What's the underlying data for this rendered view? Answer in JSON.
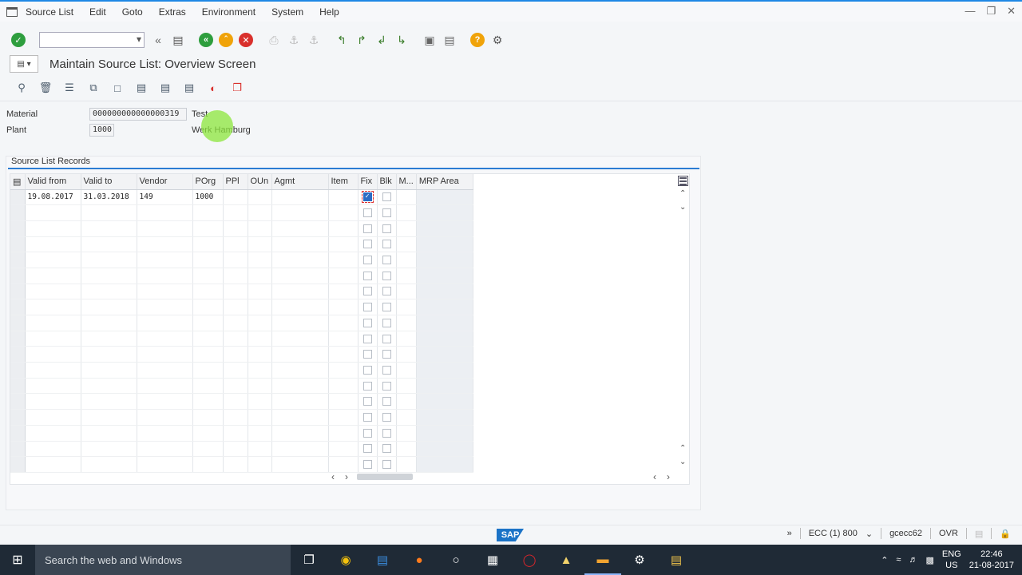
{
  "window": {
    "menu": [
      "Source List",
      "Edit",
      "Goto",
      "Extras",
      "Environment",
      "System",
      "Help"
    ],
    "controls": [
      "minimize-icon",
      "restore-icon",
      "close-icon"
    ]
  },
  "toolbar": {
    "command_field": "",
    "icons": [
      "enter-icon",
      "back-arrows-icon",
      "save-icon",
      "back-icon",
      "exit-icon",
      "cancel-icon",
      "print-icon",
      "find-icon",
      "find-next-icon",
      "first-page-icon",
      "prev-page-icon",
      "next-page-icon",
      "last-page-icon",
      "new-session-icon",
      "shortcut-icon",
      "help-icon",
      "settings-icon"
    ]
  },
  "title": {
    "text": "Maintain Source List: Overview Screen"
  },
  "app_toolbar": {
    "icons": [
      "details-icon",
      "delete-icon",
      "select-block-icon",
      "copy-icon",
      "new-icon",
      "generate-icon",
      "analyze-icon",
      "export-icon",
      "check-icon",
      "copy-doc-icon"
    ]
  },
  "header": {
    "material_label": "Material",
    "material_value": "000000000000000319",
    "material_desc": "Test",
    "plant_label": "Plant",
    "plant_value": "1000",
    "plant_desc": "Werk Hamburg"
  },
  "records": {
    "title": "Source List Records",
    "columns": [
      "Valid from",
      "Valid to",
      "Vendor",
      "POrg",
      "PPl",
      "OUn",
      "Agmt",
      "Item",
      "Fix",
      "Blk",
      "M...",
      "MRP Area"
    ],
    "rows": [
      {
        "valid_from": "19.08.2017",
        "valid_to": "31.03.2018",
        "vendor": "149",
        "porg": "1000",
        "fix": true,
        "blk": false
      }
    ],
    "empty_rows": 17
  },
  "status": {
    "system": "ECC (1) 800",
    "server": "gcecc62",
    "mode": "OVR",
    "logo": "SAP"
  },
  "taskbar": {
    "search_placeholder": "Search the web and Windows",
    "lang_top": "ENG",
    "lang_bottom": "US",
    "time": "22:46",
    "date": "21-08-2017"
  }
}
